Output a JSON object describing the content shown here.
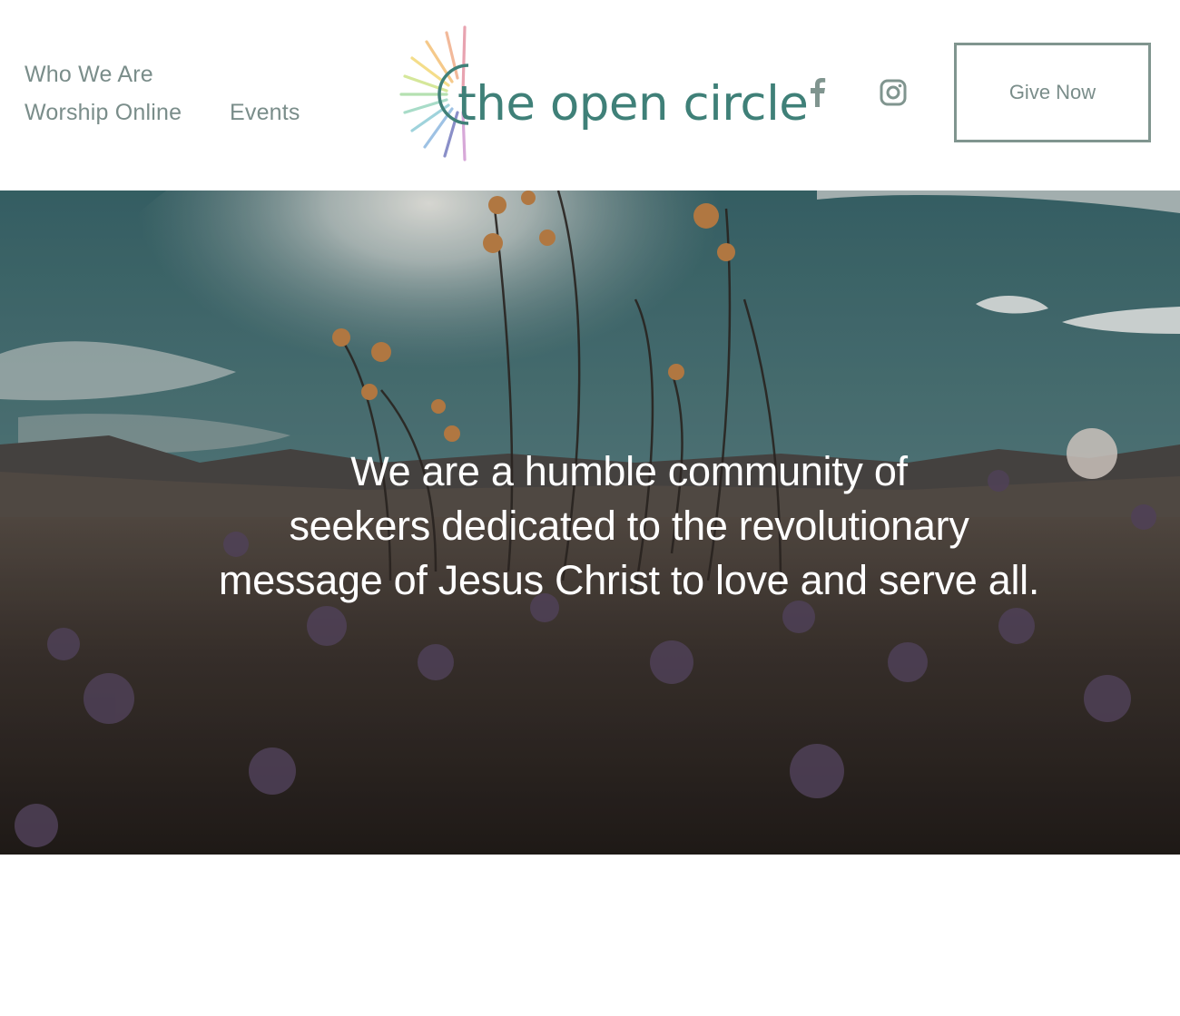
{
  "nav": {
    "who_we_are": "Who We Are",
    "worship_online": "Worship Online",
    "events": "Events"
  },
  "logo": {
    "text": "the open circle"
  },
  "social": {
    "facebook_icon": "facebook-icon",
    "instagram_icon": "instagram-icon"
  },
  "header": {
    "give_label": "Give Now"
  },
  "hero": {
    "line1": "We are a humble community of",
    "line2": "seekers dedicated to the revolutionary",
    "line3": "message of Jesus Christ to love and serve all."
  },
  "colors": {
    "nav_text": "#7a8d8a",
    "logo_teal": "#3f8078",
    "button_border": "#80958f"
  }
}
